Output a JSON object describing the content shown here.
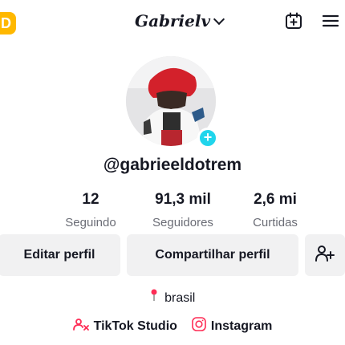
{
  "header": {
    "username": "Gabrielv",
    "promo_badge": "D",
    "icons": [
      "calendar-add-icon",
      "menu-icon"
    ]
  },
  "profile": {
    "handle": "@gabrieeldotrem",
    "avatar_icon": "avatar",
    "add_icon": "+"
  },
  "stats": [
    {
      "value": "12",
      "label": "Seguindo"
    },
    {
      "value": "91,3 mil",
      "label": "Seguidores"
    },
    {
      "value": "2,6 mi",
      "label": "Curtidas"
    }
  ],
  "actions": {
    "edit": "Editar perfil",
    "share": "Compartilhar perfil"
  },
  "bio": {
    "location": "brasil"
  },
  "links": [
    {
      "label": "TikTok Studio",
      "icon": "tiktok-studio-icon"
    },
    {
      "label": "Instagram",
      "icon": "instagram-icon"
    }
  ],
  "colors": {
    "accent": "#fe2c55",
    "add_button": "#20d5ec",
    "promo": "#ffb800",
    "button_bg": "#f1f1f2",
    "secondary_text": "#6b6d76"
  }
}
